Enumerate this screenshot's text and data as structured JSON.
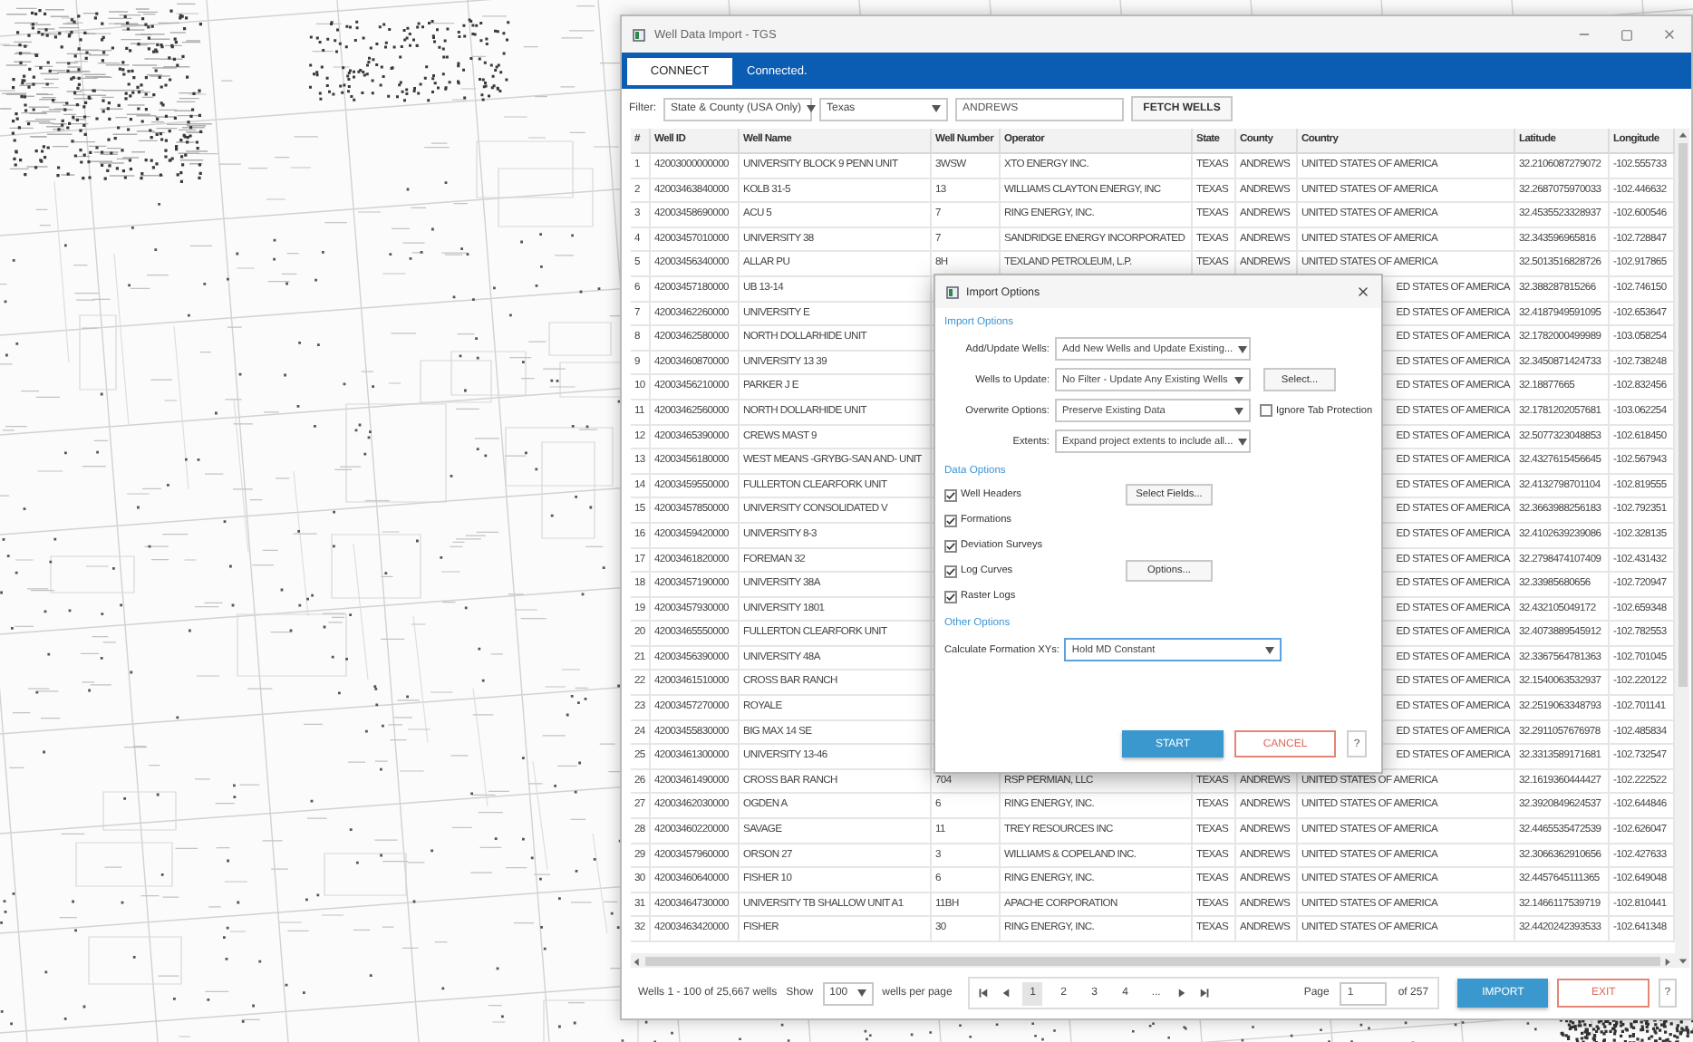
{
  "window": {
    "title": "Well Data Import - TGS"
  },
  "connection": {
    "button": "CONNECT",
    "status": "Connected."
  },
  "filter": {
    "label": "Filter:",
    "type": "State & County (USA Only)",
    "state": "Texas",
    "county": "ANDREWS",
    "button": "FETCH WELLS"
  },
  "table": {
    "columns": [
      "#",
      "Well ID",
      "Well Name",
      "Well Number",
      "Operator",
      "State",
      "County",
      "Country",
      "Latitude",
      "Longitude"
    ],
    "rows": [
      {
        "kind": "full",
        "number": "1",
        "well_id": "42003000000000",
        "well_name": "UNIVERSITY BLOCK 9 PENN UNIT",
        "well_number": "3WSW",
        "operator": "XTO ENERGY INC.",
        "state": "TEXAS",
        "county": "ANDREWS",
        "country": "UNITED STATES OF AMERICA",
        "latitude": "32.2106087279072",
        "longitude": "-102.555733"
      },
      {
        "kind": "full",
        "number": "2",
        "well_id": "42003463840000",
        "well_name": "KOLB 31-5",
        "well_number": "13",
        "operator": "WILLIAMS CLAYTON ENERGY, INC",
        "state": "TEXAS",
        "county": "ANDREWS",
        "country": "UNITED STATES OF AMERICA",
        "latitude": "32.2687075970033",
        "longitude": "-102.446632"
      },
      {
        "kind": "full",
        "number": "3",
        "well_id": "42003458690000",
        "well_name": "ACU 5",
        "well_number": "7",
        "operator": "RING ENERGY, INC.",
        "state": "TEXAS",
        "county": "ANDREWS",
        "country": "UNITED STATES OF AMERICA",
        "latitude": "32.4535523328937",
        "longitude": "-102.600546"
      },
      {
        "kind": "full",
        "number": "4",
        "well_id": "42003457010000",
        "well_name": "UNIVERSITY 38",
        "well_number": "7",
        "operator": "SANDRIDGE ENERGY INCORPORATED",
        "state": "TEXAS",
        "county": "ANDREWS",
        "country": "UNITED STATES OF AMERICA",
        "latitude": "32.343596965816",
        "longitude": "-102.728847"
      },
      {
        "kind": "full",
        "number": "5",
        "well_id": "42003456340000",
        "well_name": "ALLAR PU",
        "well_number": "8H",
        "operator": "TEXLAND PETROLEUM, L.P.",
        "state": "TEXAS",
        "county": "ANDREWS",
        "country": "UNITED STATES OF AMERICA",
        "latitude": "32.5013516828726",
        "longitude": "-102.917865"
      },
      {
        "kind": "behind_dialog",
        "number": "6",
        "well_id": "42003457180000",
        "well_name": "UB 13-14",
        "country": "ED STATES OF AMERICA",
        "latitude": "32.388287815266",
        "longitude": "-102.746150"
      },
      {
        "kind": "behind_dialog",
        "number": "7",
        "well_id": "42003462260000",
        "well_name": "UNIVERSITY E",
        "country": "ED STATES OF AMERICA",
        "latitude": "32.4187949591095",
        "longitude": "-102.653647"
      },
      {
        "kind": "behind_dialog",
        "number": "8",
        "well_id": "42003462580000",
        "well_name": "NORTH DOLLARHIDE UNIT",
        "country": "ED STATES OF AMERICA",
        "latitude": "32.1782000499989",
        "longitude": "-103.058254"
      },
      {
        "kind": "behind_dialog",
        "number": "9",
        "well_id": "42003460870000",
        "well_name": "UNIVERSITY 13 39",
        "country": "ED STATES OF AMERICA",
        "latitude": "32.3450871424733",
        "longitude": "-102.738248"
      },
      {
        "kind": "behind_dialog",
        "number": "10",
        "well_id": "42003456210000",
        "well_name": "PARKER J E",
        "country": "ED STATES OF AMERICA",
        "latitude": "32.18877665",
        "longitude": "-102.832456"
      },
      {
        "kind": "behind_dialog",
        "number": "11",
        "well_id": "42003462560000",
        "well_name": "NORTH DOLLARHIDE UNIT",
        "country": "ED STATES OF AMERICA",
        "latitude": "32.1781202057681",
        "longitude": "-103.062254"
      },
      {
        "kind": "behind_dialog",
        "number": "12",
        "well_id": "42003465390000",
        "well_name": "CREWS MAST 9",
        "country": "ED STATES OF AMERICA",
        "latitude": "32.5077323048853",
        "longitude": "-102.618450"
      },
      {
        "kind": "behind_dialog",
        "number": "13",
        "well_id": "42003456180000",
        "well_name": "WEST MEANS -GRYBG-SAN AND- UNIT",
        "country": "ED STATES OF AMERICA",
        "latitude": "32.4327615456645",
        "longitude": "-102.567943"
      },
      {
        "kind": "behind_dialog",
        "number": "14",
        "well_id": "42003459550000",
        "well_name": "FULLERTON CLEARFORK UNIT",
        "country": "ED STATES OF AMERICA",
        "latitude": "32.4132798701104",
        "longitude": "-102.819555"
      },
      {
        "kind": "behind_dialog",
        "number": "15",
        "well_id": "42003457850000",
        "well_name": "UNIVERSITY CONSOLIDATED V",
        "country": "ED STATES OF AMERICA",
        "latitude": "32.3663988256183",
        "longitude": "-102.792351"
      },
      {
        "kind": "behind_dialog",
        "number": "16",
        "well_id": "42003459420000",
        "well_name": "UNIVERSITY 8-3",
        "country": "ED STATES OF AMERICA",
        "latitude": "32.4102639239086",
        "longitude": "-102.328135"
      },
      {
        "kind": "behind_dialog",
        "number": "17",
        "well_id": "42003461820000",
        "well_name": "FOREMAN 32",
        "country": "ED STATES OF AMERICA",
        "latitude": "32.2798474107409",
        "longitude": "-102.431432"
      },
      {
        "kind": "behind_dialog",
        "number": "18",
        "well_id": "42003457190000",
        "well_name": "UNIVERSITY 38A",
        "country": "ED STATES OF AMERICA",
        "latitude": "32.33985680656",
        "longitude": "-102.720947"
      },
      {
        "kind": "behind_dialog",
        "number": "19",
        "well_id": "42003457930000",
        "well_name": "UNIVERSITY 1801",
        "country": "ED STATES OF AMERICA",
        "latitude": "32.432105049172",
        "longitude": "-102.659348"
      },
      {
        "kind": "behind_dialog",
        "number": "20",
        "well_id": "42003465550000",
        "well_name": "FULLERTON CLEARFORK UNIT",
        "country": "ED STATES OF AMERICA",
        "latitude": "32.4073889545912",
        "longitude": "-102.782553"
      },
      {
        "kind": "behind_dialog",
        "number": "21",
        "well_id": "42003456390000",
        "well_name": "UNIVERSITY 48A",
        "country": "ED STATES OF AMERICA",
        "latitude": "32.3367564781363",
        "longitude": "-102.701045"
      },
      {
        "kind": "behind_dialog",
        "number": "22",
        "well_id": "42003461510000",
        "well_name": "CROSS BAR RANCH",
        "country": "ED STATES OF AMERICA",
        "latitude": "32.1540063532937",
        "longitude": "-102.220122"
      },
      {
        "kind": "behind_dialog",
        "number": "23",
        "well_id": "42003457270000",
        "well_name": "ROYALE",
        "country": "ED STATES OF AMERICA",
        "latitude": "32.2519063348793",
        "longitude": "-102.701141"
      },
      {
        "kind": "behind_dialog",
        "number": "24",
        "well_id": "42003455830000",
        "well_name": "BIG MAX 14 SE",
        "country": "ED STATES OF AMERICA",
        "latitude": "32.2911057676978",
        "longitude": "-102.485834"
      },
      {
        "kind": "behind_dialog",
        "number": "25",
        "well_id": "42003461300000",
        "well_name": "UNIVERSITY 13-46",
        "country": "ED STATES OF AMERICA",
        "latitude": "32.3313589171681",
        "longitude": "-102.732547"
      },
      {
        "kind": "full",
        "number": "26",
        "well_id": "42003461490000",
        "well_name": "CROSS BAR RANCH",
        "well_number": "704",
        "operator": "RSP PERMIAN, LLC",
        "state": "TEXAS",
        "county": "ANDREWS",
        "country": "UNITED STATES OF AMERICA",
        "latitude": "32.1619360444427",
        "longitude": "-102.222522"
      },
      {
        "kind": "full",
        "number": "27",
        "well_id": "42003462030000",
        "well_name": "OGDEN A",
        "well_number": "6",
        "operator": "RING ENERGY, INC.",
        "state": "TEXAS",
        "county": "ANDREWS",
        "country": "UNITED STATES OF AMERICA",
        "latitude": "32.3920849624537",
        "longitude": "-102.644846"
      },
      {
        "kind": "full",
        "number": "28",
        "well_id": "42003460220000",
        "well_name": "SAVAGE",
        "well_number": "11",
        "operator": "TREY RESOURCES INC",
        "state": "TEXAS",
        "county": "ANDREWS",
        "country": "UNITED STATES OF AMERICA",
        "latitude": "32.4465535472539",
        "longitude": "-102.626047"
      },
      {
        "kind": "full",
        "number": "29",
        "well_id": "42003457960000",
        "well_name": "ORSON 27",
        "well_number": "3",
        "operator": "WILLIAMS & COPELAND INC.",
        "state": "TEXAS",
        "county": "ANDREWS",
        "country": "UNITED STATES OF AMERICA",
        "latitude": "32.3066362910656",
        "longitude": "-102.427633"
      },
      {
        "kind": "full",
        "number": "30",
        "well_id": "42003460640000",
        "well_name": "FISHER 10",
        "well_number": "6",
        "operator": "RING ENERGY, INC.",
        "state": "TEXAS",
        "county": "ANDREWS",
        "country": "UNITED STATES OF AMERICA",
        "latitude": "32.4457645111365",
        "longitude": "-102.649048"
      },
      {
        "kind": "full",
        "number": "31",
        "well_id": "42003464730000",
        "well_name": "UNIVERSITY TB SHALLOW UNIT A1",
        "well_number": "11BH",
        "operator": "APACHE CORPORATION",
        "state": "TEXAS",
        "county": "ANDREWS",
        "country": "UNITED STATES OF AMERICA",
        "latitude": "32.1466117539719",
        "longitude": "-102.810441"
      },
      {
        "kind": "full",
        "number": "32",
        "well_id": "42003463420000",
        "well_name": "FISHER",
        "well_number": "30",
        "operator": "RING ENERGY, INC.",
        "state": "TEXAS",
        "county": "ANDREWS",
        "country": "UNITED STATES OF AMERICA",
        "latitude": "32.4420242393533",
        "longitude": "-102.641348"
      }
    ]
  },
  "footer": {
    "summary": "Wells 1 - 100 of 25,667 wells",
    "show_label": "Show",
    "per_page": "100",
    "per_page_label": "wells per page",
    "pages": [
      {
        "label": "1",
        "selected": true
      },
      {
        "label": "2",
        "selected": false
      },
      {
        "label": "3",
        "selected": false
      },
      {
        "label": "4",
        "selected": false
      },
      {
        "label": "...",
        "selected": false
      }
    ],
    "page_label": "Page",
    "page": "1",
    "page_total": "of 257",
    "import_button": "IMPORT",
    "exit_button": "EXIT",
    "help_button": "?"
  },
  "dialog": {
    "title": "Import Options",
    "import_heading": "Import Options",
    "import_rows": [
      {
        "label": "Add/Update Wells:",
        "value": "Add New Wells and Update Existing..."
      },
      {
        "label": "Wells to Update:",
        "value": "No Filter - Update Any Existing Wells",
        "button": "Select..."
      },
      {
        "label": "Overwrite Options:",
        "value": "Preserve Existing Data",
        "checkbox": {
          "label": "Ignore Tab Protection",
          "checked": false
        }
      },
      {
        "label": "Extents:",
        "value": "Expand project extents to include all..."
      }
    ],
    "data_heading": "Data Options",
    "data_items": [
      {
        "label": "Well Headers",
        "checked": true,
        "button": "Select Fields..."
      },
      {
        "label": "Formations",
        "checked": true
      },
      {
        "label": "Deviation Surveys",
        "checked": true
      },
      {
        "label": "Log Curves",
        "checked": true,
        "button": "Options..."
      },
      {
        "label": "Raster Logs",
        "checked": true
      }
    ],
    "other_heading": "Other Options",
    "formation": {
      "label": "Calculate Formation XYs:",
      "value": "Hold MD Constant",
      "focused": true
    },
    "start_button": "START",
    "cancel_button": "CANCEL",
    "help_button": "?"
  }
}
